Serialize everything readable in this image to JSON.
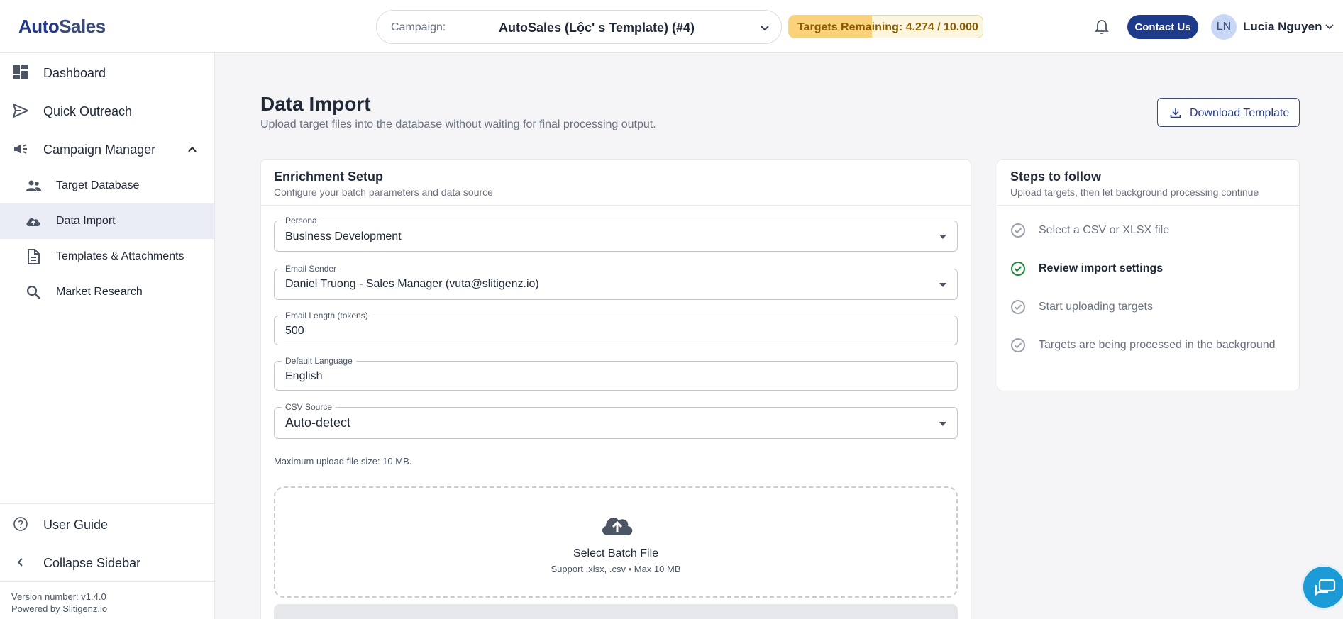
{
  "header": {
    "logo_part1": "Auto",
    "logo_part2": "Sales",
    "campaign_label": "Campaign:",
    "campaign_value": "AutoSales (Lộc' s Template) (#4)",
    "targets_text": "Targets Remaining: 4.274 / 10.000",
    "targets_used_fraction": 0.4274,
    "contact_label": "Contact Us",
    "avatar_initials": "LN",
    "user_name": "Lucia Nguyen"
  },
  "sidebar": {
    "items": [
      {
        "label": "Dashboard",
        "icon": "dashboard-icon"
      },
      {
        "label": "Quick Outreach",
        "icon": "send-icon"
      },
      {
        "label": "Campaign Manager",
        "icon": "megaphone-icon"
      },
      {
        "label": "Target Database",
        "icon": "people-icon"
      },
      {
        "label": "Data Import",
        "icon": "cloud-upload-icon",
        "active": true
      },
      {
        "label": "Templates & Attachments",
        "icon": "document-icon"
      },
      {
        "label": "Market Research",
        "icon": "search-icon"
      }
    ],
    "user_guide": "User Guide",
    "collapse": "Collapse Sidebar",
    "version": "Version number: v1.4.0",
    "powered": "Powered by Slitigenz.io"
  },
  "main": {
    "title": "Data Import",
    "subtitle": "Upload target files into the database without waiting for final processing output.",
    "download_label": "Download Template",
    "setup": {
      "title": "Enrichment Setup",
      "subtitle": "Configure your batch parameters and data source",
      "persona_label": "Persona",
      "persona_value": "Business Development",
      "sender_label": "Email Sender",
      "sender_value": "Daniel Truong - Sales Manager (vuta@slitigenz.io)",
      "length_label": "Email Length (tokens)",
      "length_value": "500",
      "language_label": "Default Language",
      "language_value": "English",
      "csv_label": "CSV Source",
      "csv_value": "Auto-detect",
      "max_size": "Maximum upload file size: 10 MB.",
      "drop_title": "Select Batch File",
      "drop_sub": "Support .xlsx, .csv • Max 10 MB"
    },
    "steps": {
      "title": "Steps to follow",
      "subtitle": "Upload targets, then let background processing continue",
      "items": [
        {
          "label": "Select a CSV or XLSX file",
          "state": "pending"
        },
        {
          "label": "Review import settings",
          "state": "active"
        },
        {
          "label": "Start uploading targets",
          "state": "pending"
        },
        {
          "label": "Targets are being processed in the background",
          "state": "pending"
        }
      ]
    }
  },
  "colors": {
    "brand": "#22398a",
    "accent_green": "#1f8a3a",
    "targets_bg": "#f9d27a",
    "chat": "#1b9ad6"
  }
}
